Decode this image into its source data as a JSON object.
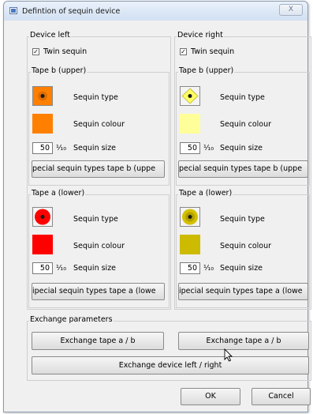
{
  "window": {
    "title": "Defintion of sequin device",
    "close_glyph": "X"
  },
  "left": {
    "header": "Device left",
    "twin": "Twin sequin",
    "tape_b": {
      "header": "Tape b (upper)",
      "type_label": "Sequin type",
      "colour_label": "Sequin colour",
      "size_value": "50",
      "size_unit": "⅟₁₀",
      "size_label": "Sequin size",
      "special_btn": "pecial sequin types tape b (uppe",
      "colour": "#ff8000",
      "pattern_fill": "#ff8000",
      "pattern_center": "#1a1a1a"
    },
    "tape_a": {
      "header": "Tape a (lower)",
      "type_label": "Sequin type",
      "colour_label": "Sequin colour",
      "size_value": "50",
      "size_unit": "⅟₁₀",
      "size_label": "Sequin size",
      "special_btn": "ipecial sequin types tape a (lowe",
      "colour": "#ff0000",
      "pattern_fill": "#ff0000",
      "pattern_center": "#1a1a1a"
    }
  },
  "right": {
    "header": "Device right",
    "twin": "Twin sequin",
    "tape_b": {
      "header": "Tape b (upper)",
      "type_label": "Sequin type",
      "colour_label": "Sequin colour",
      "size_value": "50",
      "size_unit": "⅟₁₀",
      "size_label": "Sequin size",
      "special_btn": "pecial sequin types tape b (uppe",
      "colour": "#ffff99",
      "pattern_fill": "#ffff66",
      "pattern_center": "#1a1a1a"
    },
    "tape_a": {
      "header": "Tape a (lower)",
      "type_label": "Sequin type",
      "colour_label": "Sequin colour",
      "size_value": "50",
      "size_unit": "⅟₁₀",
      "size_label": "Sequin size",
      "special_btn": "ipecial sequin types tape a (lowe",
      "colour": "#ccbb00",
      "pattern_fill": "#d4c000",
      "pattern_center": "#1a1a1a"
    }
  },
  "exchange": {
    "header": "Exchange parameters",
    "btn_tape_left": "Exchange tape a / b",
    "btn_tape_right": "Exchange tape a / b",
    "btn_device": "Exchange device left / right"
  },
  "footer": {
    "ok": "OK",
    "cancel": "Cancel"
  }
}
